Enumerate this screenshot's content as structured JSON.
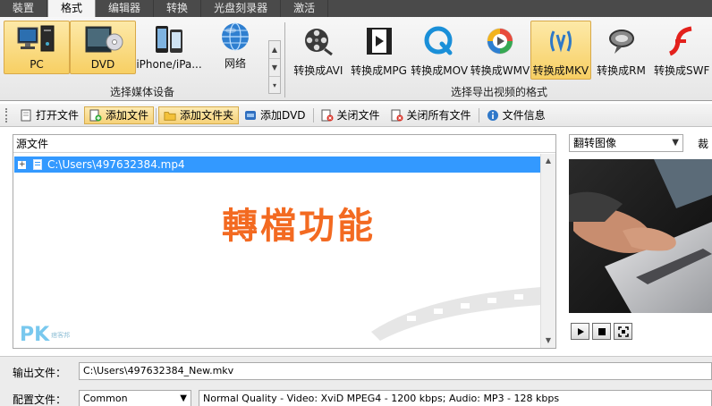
{
  "tabs": [
    "裝置",
    "格式",
    "编辑器",
    "转换",
    "光盘刻录器",
    "激活"
  ],
  "active_tab_index": 1,
  "devices": [
    {
      "label": "PC",
      "icon": "desktop-pc-icon",
      "selected": true
    },
    {
      "label": "DVD",
      "icon": "dvd-disc-icon",
      "selected": true
    },
    {
      "label": "iPhone/iPa...",
      "icon": "iphone-icon",
      "selected": false
    },
    {
      "label": "网络",
      "icon": "globe-icon",
      "selected": false
    }
  ],
  "devices_group_label": "选择媒体设备",
  "formats": [
    {
      "label": "转换成AVI",
      "icon": "film-reel-icon",
      "selected": false
    },
    {
      "label": "转换成MPG",
      "icon": "film-strip-icon",
      "selected": false
    },
    {
      "label": "转换成MOV",
      "icon": "quicktime-icon",
      "selected": false
    },
    {
      "label": "转换成WMV",
      "icon": "media-player-icon",
      "selected": false
    },
    {
      "label": "转换成MKV",
      "icon": "mkv-icon",
      "selected": true
    },
    {
      "label": "转换成RM",
      "icon": "realmedia-icon",
      "selected": false
    },
    {
      "label": "转换成SWF",
      "icon": "flash-icon",
      "selected": false
    }
  ],
  "formats_group_label": "选择导出视频的格式",
  "toolbar": [
    {
      "label": "打开文件",
      "icon": "open-file-icon",
      "selected": false
    },
    {
      "label": "添加文件",
      "icon": "add-file-icon",
      "selected": true
    },
    {
      "label": "添加文件夹",
      "icon": "add-folder-icon",
      "selected": true
    },
    {
      "label": "添加DVD",
      "icon": "add-dvd-icon",
      "selected": false
    },
    {
      "label": "关闭文件",
      "icon": "close-file-icon",
      "selected": false
    },
    {
      "label": "关闭所有文件",
      "icon": "close-all-icon",
      "selected": false
    },
    {
      "label": "文件信息",
      "icon": "info-icon",
      "selected": false
    }
  ],
  "source": {
    "header": "源文件",
    "file": "C:\\Users\\497632384.mp4",
    "expander": "+"
  },
  "overlay_title": "轉檔功能",
  "watermark": {
    "brand": "PK",
    "sub": "痞客邦"
  },
  "preview": {
    "select_value": "翻转图像",
    "crop_label": "裁"
  },
  "output": {
    "label": "输出文件：",
    "value": "C:\\Users\\497632384_New.mkv"
  },
  "profile": {
    "label": "配置文件：",
    "value": "Common",
    "description": "Normal Quality - Video: XviD MPEG4 - 1200 kbps; Audio: MP3 - 128 kbps"
  },
  "colors": {
    "selection_blue": "#3399ff",
    "overlay_orange": "#f36a21",
    "ribbon_selected": "#f7cf63"
  }
}
